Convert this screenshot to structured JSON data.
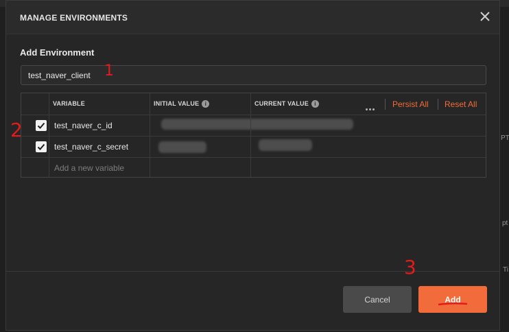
{
  "dialog": {
    "title": "MANAGE ENVIRONMENTS",
    "section_title": "Add Environment",
    "environment_name": "test_naver_client"
  },
  "table": {
    "headers": {
      "variable": "VARIABLE",
      "initial_value": "INITIAL VALUE",
      "current_value": "CURRENT VALUE"
    },
    "actions": {
      "persist_all": "Persist All",
      "reset_all": "Reset All"
    },
    "rows": [
      {
        "checked": true,
        "variable": "test_naver_c_id"
      },
      {
        "checked": true,
        "variable": "test_naver_c_secret"
      }
    ],
    "new_variable_placeholder": "Add a new variable"
  },
  "buttons": {
    "cancel": "Cancel",
    "add": "Add"
  },
  "annotations": {
    "one": "1",
    "two": "2",
    "three": "3"
  },
  "background": {
    "right_edge_text_1": "PTE",
    "right_edge_text_2": "pt",
    "right_edge_text_3": "Ti"
  },
  "colors": {
    "accent": "#f26b3a",
    "annotation_red": "#e31b1b",
    "modal_bg": "#262626"
  }
}
